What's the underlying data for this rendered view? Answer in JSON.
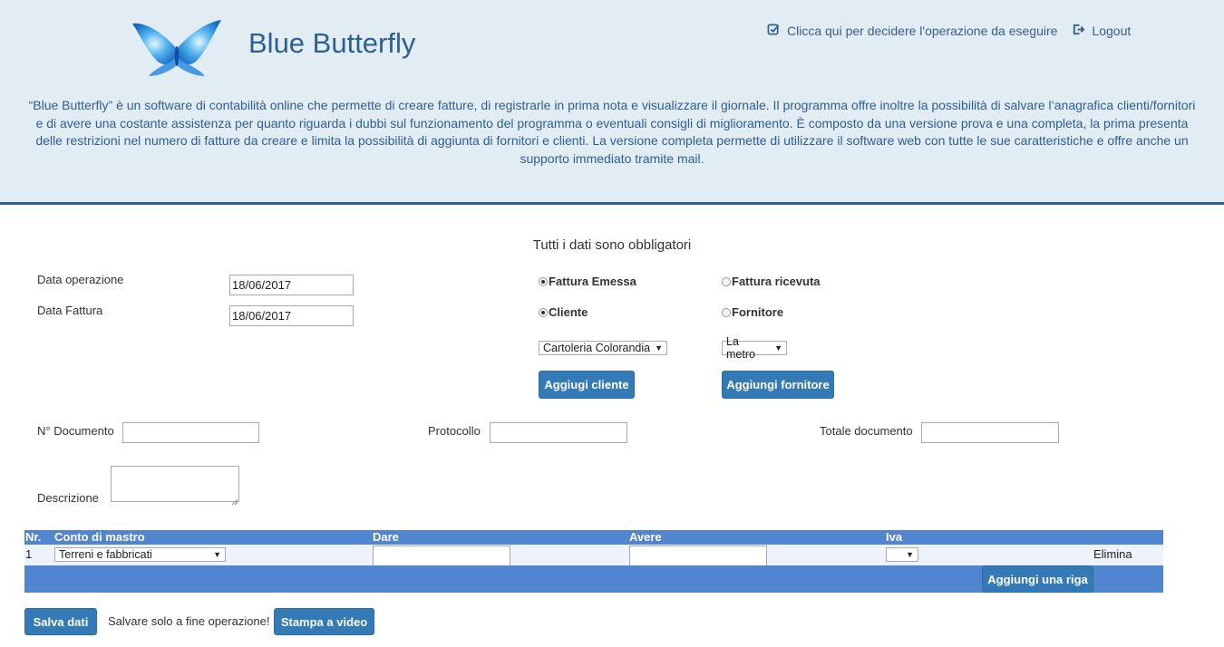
{
  "header": {
    "app_title": "Blue Butterfly",
    "nav": {
      "choose_operation": "Clicca qui per decidere l'operazione da eseguire",
      "logout": "Logout"
    },
    "intro": "“Blue Butterfly” è un software di contabilità online che permette di creare fatture, di registrarle in prima nota e visualizzare il giornale. Il programma offre inoltre la possibilità di salvare l’anagrafica clienti/fornitori e di avere una costante assistenza per quanto riguarda i dubbi sul funzionamento del programma o eventuali consigli di miglioramento. È composto da una versione prova e una completa, la prima presenta delle restrizioni nel numero di fatture da creare e limita la possibilità di aggiunta di fornitori e clienti. La versione completa permette di utilizzare il software web con tutte le sue caratteristiche e offre anche un supporto immediato tramite mail."
  },
  "form": {
    "notice": "Tutti i dati sono obbligatori",
    "data_operazione": {
      "label": "Data operazione",
      "value": "18/06/2017"
    },
    "data_fattura": {
      "label": "Data Fattura",
      "value": "18/06/2017"
    },
    "radio_fattura_emessa": {
      "label": "Fattura Emessa",
      "checked": true
    },
    "radio_fattura_ricevuta": {
      "label": "Fattura ricevuta",
      "checked": false
    },
    "radio_cliente": {
      "label": "Cliente",
      "checked": true
    },
    "radio_fornitore": {
      "label": "Fornitore",
      "checked": false
    },
    "select_cliente": "Cartoleria Colorandia",
    "select_fornitore": "La metro",
    "btn_aggiungi_cliente": "Aggiugi cliente",
    "btn_aggiungi_fornitore": "Aggiungi fornitore",
    "n_documento": {
      "label": "N° Documento",
      "value": ""
    },
    "protocollo": {
      "label": "Protocollo",
      "value": ""
    },
    "totale_documento": {
      "label": "Totale documento",
      "value": ""
    },
    "descrizione": {
      "label": "Descrizione",
      "value": ""
    }
  },
  "table": {
    "columns": [
      "Nr.",
      "Conto di mastro",
      "Dare",
      "Avere",
      "Iva"
    ],
    "rows": [
      {
        "nr": "1",
        "conto": "Terreni e fabbricati",
        "dare": "",
        "avere": "",
        "iva": "",
        "elimina": "Elimina"
      }
    ],
    "btn_aggiungi_riga": "Aggiungi una riga"
  },
  "footer": {
    "btn_salva": "Salva dati",
    "note": "Salvare solo a fine operazione!",
    "btn_stampa": "Stampa a video"
  },
  "colors": {
    "header_bg": "#e1ecf3",
    "header_border": "#286090",
    "primary_button": "#337ab7",
    "table_header": "#5285cf",
    "title_text": "#2e5f92"
  }
}
